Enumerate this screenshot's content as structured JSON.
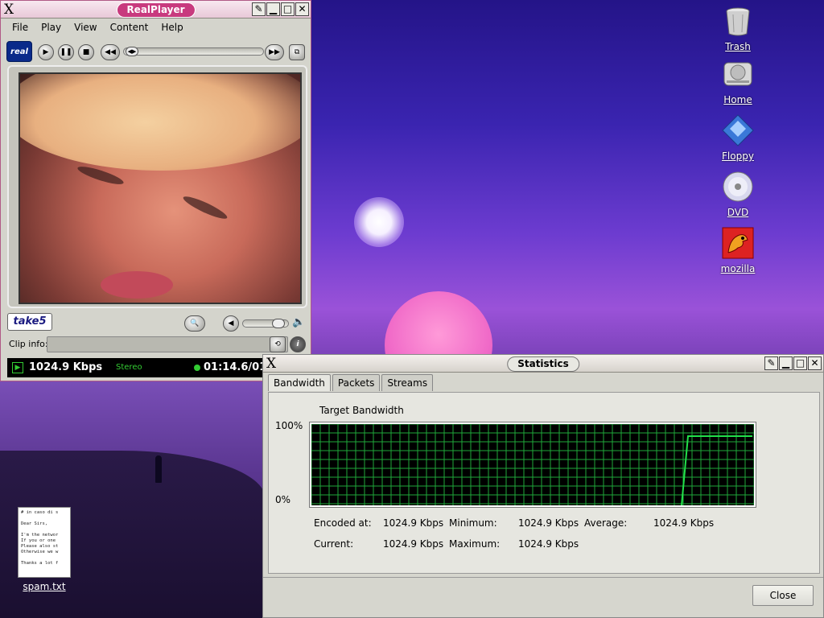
{
  "desktop": {
    "icons": [
      {
        "label": "Trash"
      },
      {
        "label": "Home"
      },
      {
        "label": "Floppy"
      },
      {
        "label": "DVD"
      },
      {
        "label": "mozilla"
      }
    ],
    "note": {
      "label": "spam.txt",
      "preview": "# in caso di s\n\nDear Sirs,\n\nI'm the networ\nIf you or one\nPlease also st\nOtherwise we w\n\nThanks a lot f"
    }
  },
  "realplayer": {
    "title": "RealPlayer",
    "menu": [
      "File",
      "Play",
      "View",
      "Content",
      "Help"
    ],
    "logo_text": "real",
    "take5_label": "take5",
    "clip_info_label": "Clip info:",
    "bitrate": "1024.9 Kbps",
    "stereo_label": "Stereo",
    "time": "01:14.6/01:"
  },
  "statistics": {
    "title": "Statistics",
    "tabs": [
      "Bandwidth",
      "Packets",
      "Streams"
    ],
    "active_tab": "Bandwidth",
    "graph_title": "Target Bandwidth",
    "y_top": "100%",
    "y_bottom": "0%",
    "encoded_label": "Encoded at:",
    "encoded_value": "1024.9 Kbps",
    "minimum_label": "Minimum:",
    "minimum_value": "1024.9 Kbps",
    "average_label": "Average:",
    "average_value": "1024.9 Kbps",
    "current_label": "Current:",
    "current_value": "1024.9 Kbps",
    "maximum_label": "Maximum:",
    "maximum_value": "1024.9 Kbps",
    "close_label": "Close",
    "grid_color": "#1fa83a",
    "line_color": "#22e04a"
  },
  "icons": {
    "window_close": "X",
    "window_pin": "pin-icon",
    "window_min": "minimize-icon",
    "window_max": "maximize-icon"
  }
}
